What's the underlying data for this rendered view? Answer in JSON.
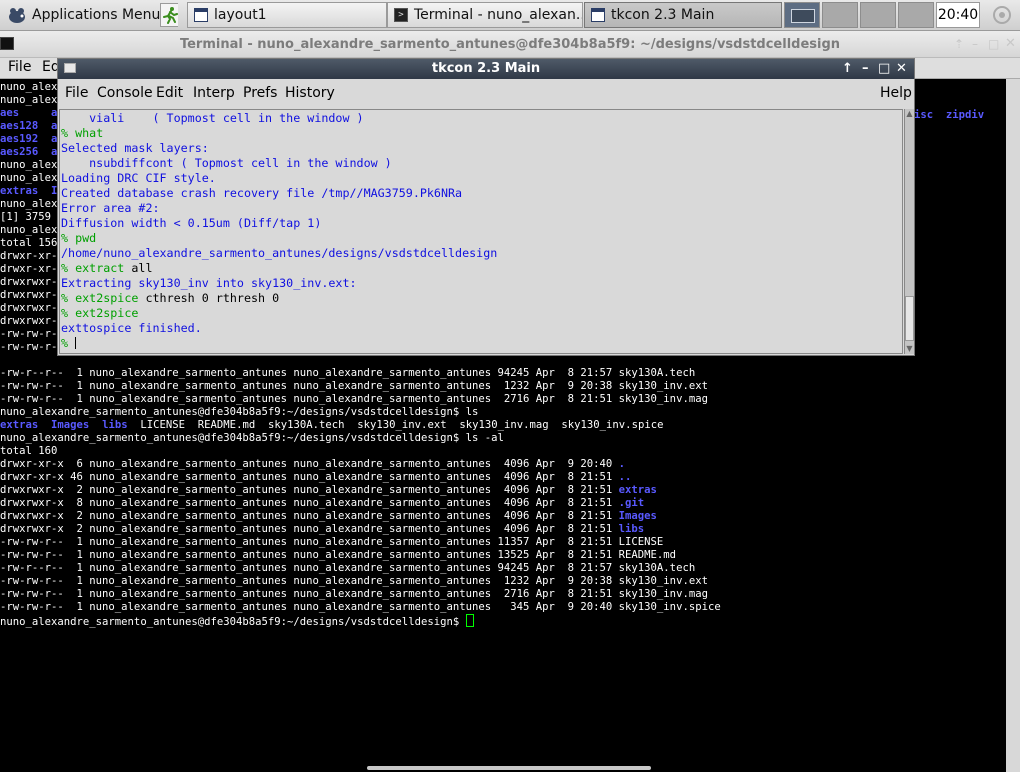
{
  "taskbar": {
    "apps_menu": "Applications Menu",
    "tasks": [
      "layout1",
      "Terminal - nuno_alexan...",
      "tkcon 2.3 Main"
    ],
    "clock": "20:40"
  },
  "terminal": {
    "title": "Terminal - nuno_alexandre_sarmento_antunes@dfe304b8a5f9: ~/designs/vsdstdcelldesign",
    "menu": [
      "File",
      "Ed"
    ],
    "left_fragments": [
      {
        "text": "nuno_alexa",
        "blue": false
      },
      {
        "text": "nuno_alexa",
        "blue": false
      },
      {
        "text": "aes     a",
        "blue": true
      },
      {
        "text": "aes128  a",
        "blue": true
      },
      {
        "text": "aes192  a",
        "blue": true
      },
      {
        "text": "aes256  a",
        "blue": true
      },
      {
        "text": "nuno_alexa",
        "blue": false
      },
      {
        "text": "nuno_alexa",
        "blue": false
      },
      {
        "text": "extras  I",
        "blue": true
      },
      {
        "text": "nuno_alexa",
        "blue": false
      },
      {
        "text": "[1] 3759",
        "blue": false
      },
      {
        "text": "nuno_alexa",
        "blue": false
      },
      {
        "text": "total 156",
        "blue": false
      },
      {
        "text": "drwxr-xr-x",
        "blue": false
      },
      {
        "text": "drwxr-xr-x",
        "blue": false
      },
      {
        "text": "drwxrwxr-x",
        "blue": false
      },
      {
        "text": "drwxrwxr-x",
        "blue": false
      },
      {
        "text": "drwxrwxr-x",
        "blue": false
      },
      {
        "text": "drwxrwxr-x",
        "blue": false
      },
      {
        "text": "-rw-rw-r--",
        "blue": false
      },
      {
        "text": "-rw-rw-r--",
        "blue": false
      }
    ],
    "right_fragment": "isc  zipdiv",
    "lines": [
      "-rw-r--r--  1 nuno_alexandre_sarmento_antunes nuno_alexandre_sarmento_antunes 94245 Apr  8 21:57 sky130A.tech",
      "-rw-rw-r--  1 nuno_alexandre_sarmento_antunes nuno_alexandre_sarmento_antunes  1232 Apr  9 20:38 sky130_inv.ext",
      "-rw-rw-r--  1 nuno_alexandre_sarmento_antunes nuno_alexandre_sarmento_antunes  2716 Apr  8 21:51 sky130_inv.mag",
      "nuno_alexandre_sarmento_antunes@dfe304b8a5f9:~/designs/vsdstdcelldesign$ ls",
      "extras  Images  libs  LICENSE  README.md  sky130A.tech  sky130_inv.ext  sky130_inv.mag  sky130_inv.spice",
      "nuno_alexandre_sarmento_antunes@dfe304b8a5f9:~/designs/vsdstdcelldesign$ ls -al",
      "total 160",
      "drwxr-xr-x  6 nuno_alexandre_sarmento_antunes nuno_alexandre_sarmento_antunes  4096 Apr  9 20:40 .",
      "drwxr-xr-x 46 nuno_alexandre_sarmento_antunes nuno_alexandre_sarmento_antunes  4096 Apr  8 21:51 ..",
      "drwxrwxr-x  2 nuno_alexandre_sarmento_antunes nuno_alexandre_sarmento_antunes  4096 Apr  8 21:51 extras",
      "drwxrwxr-x  8 nuno_alexandre_sarmento_antunes nuno_alexandre_sarmento_antunes  4096 Apr  8 21:51 .git",
      "drwxrwxr-x  2 nuno_alexandre_sarmento_antunes nuno_alexandre_sarmento_antunes  4096 Apr  8 21:51 Images",
      "drwxrwxr-x  2 nuno_alexandre_sarmento_antunes nuno_alexandre_sarmento_antunes  4096 Apr  8 21:51 libs",
      "-rw-rw-r--  1 nuno_alexandre_sarmento_antunes nuno_alexandre_sarmento_antunes 11357 Apr  8 21:51 LICENSE",
      "-rw-rw-r--  1 nuno_alexandre_sarmento_antunes nuno_alexandre_sarmento_antunes 13525 Apr  8 21:51 README.md",
      "-rw-r--r--  1 nuno_alexandre_sarmento_antunes nuno_alexandre_sarmento_antunes 94245 Apr  8 21:57 sky130A.tech",
      "-rw-rw-r--  1 nuno_alexandre_sarmento_antunes nuno_alexandre_sarmento_antunes  1232 Apr  9 20:38 sky130_inv.ext",
      "-rw-rw-r--  1 nuno_alexandre_sarmento_antunes nuno_alexandre_sarmento_antunes  2716 Apr  8 21:51 sky130_inv.mag",
      "-rw-rw-r--  1 nuno_alexandre_sarmento_antunes nuno_alexandre_sarmento_antunes   345 Apr  9 20:40 sky130_inv.spice",
      "nuno_alexandre_sarmento_antunes@dfe304b8a5f9:~/designs/vsdstdcelldesign$ "
    ]
  },
  "tkcon": {
    "title": "tkcon 2.3 Main",
    "menu": [
      "File",
      "Console",
      "Edit",
      "Interp",
      "Prefs",
      "History"
    ],
    "help": "Help",
    "lines": [
      {
        "p": "",
        "c": "",
        "t": "    viali    ( Topmost cell in the window )"
      },
      {
        "p": "% ",
        "c": "what",
        "t": ""
      },
      {
        "p": "",
        "c": "",
        "t": "Selected mask layers:"
      },
      {
        "p": "",
        "c": "",
        "t": "    nsubdiffcont ( Topmost cell in the window )"
      },
      {
        "p": "",
        "c": "",
        "t": "Loading DRC CIF style."
      },
      {
        "p": "",
        "c": "",
        "t": "Created database crash recovery file /tmp//MAG3759.Pk6NRa"
      },
      {
        "p": "",
        "c": "",
        "t": "Error area #2:"
      },
      {
        "p": "",
        "c": "",
        "t": "Diffusion width < 0.15um (Diff/tap 1)"
      },
      {
        "p": "% ",
        "c": "pwd",
        "t": ""
      },
      {
        "p": "",
        "c": "",
        "t": "/home/nuno_alexandre_sarmento_antunes/designs/vsdstdcelldesign"
      },
      {
        "p": "% ",
        "c": "extract",
        "t": " all"
      },
      {
        "p": "",
        "c": "",
        "t": "Extracting sky130_inv into sky130_inv.ext:"
      },
      {
        "p": "% ",
        "c": "ext2spice",
        "t": " cthresh 0 rthresh 0"
      },
      {
        "p": "% ",
        "c": "ext2spice",
        "t": ""
      },
      {
        "p": "",
        "c": "",
        "t": "exttospice finished."
      },
      {
        "p": "% ",
        "c": "",
        "t": ""
      }
    ]
  }
}
